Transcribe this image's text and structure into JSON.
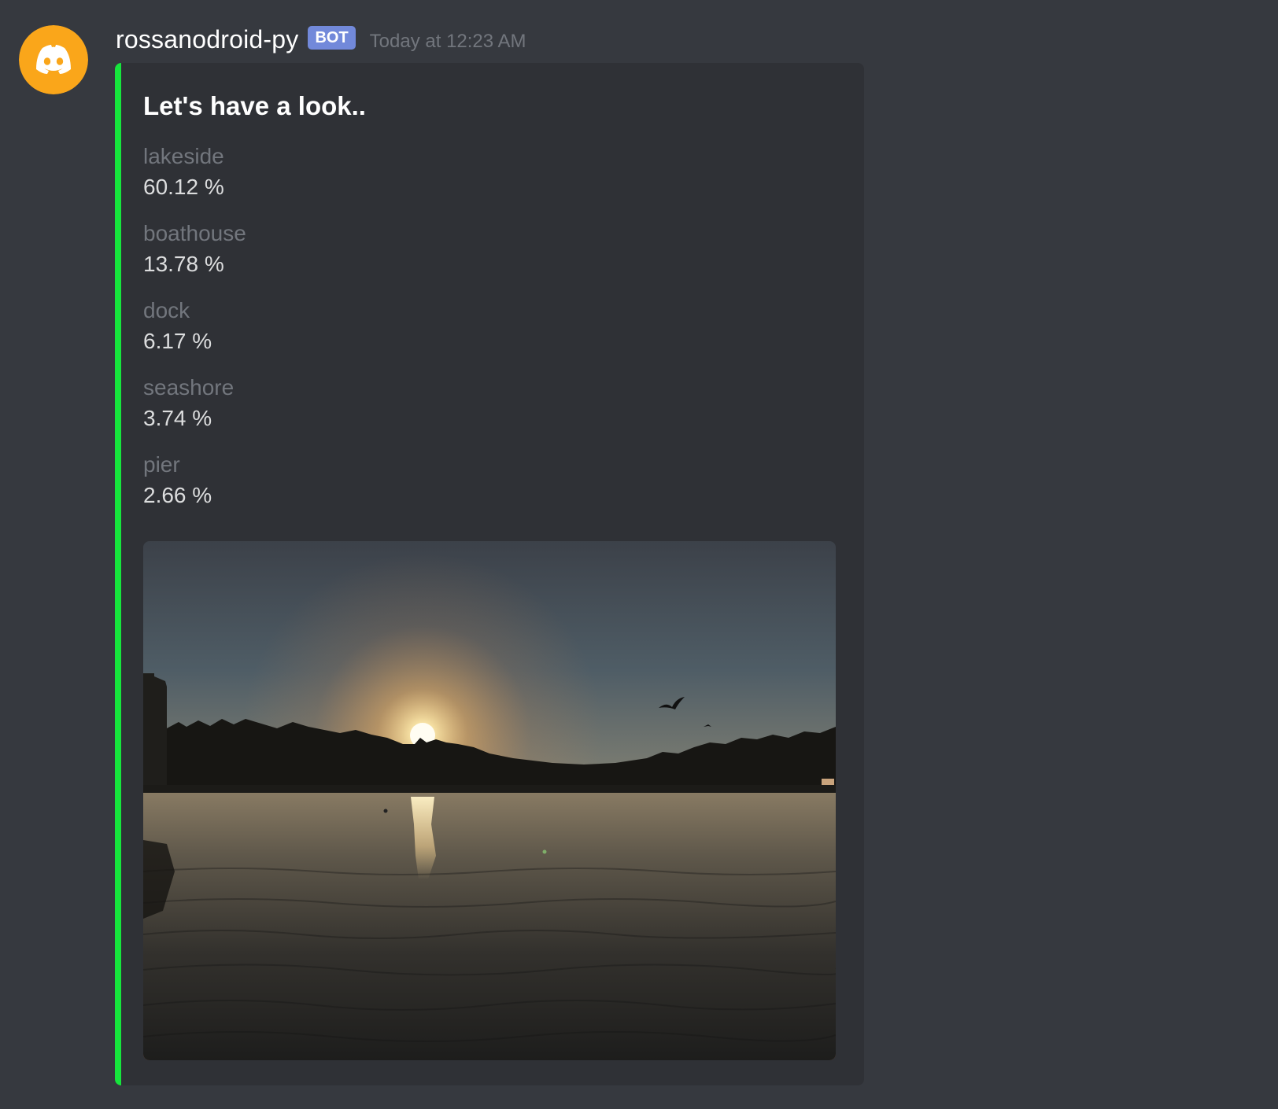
{
  "author": {
    "username": "rossanodroid-py",
    "tag": "BOT",
    "timestamp": "Today at 12:23 AM",
    "avatar_icon": "discord-logo-icon",
    "avatar_color": "#faa61a"
  },
  "embed": {
    "accent_color": "#16e53c",
    "title": "Let's have a look..",
    "fields": [
      {
        "name": "lakeside",
        "value": "60.12 %"
      },
      {
        "name": "boathouse",
        "value": "13.78 %"
      },
      {
        "name": "dock",
        "value": "6.17 %"
      },
      {
        "name": "seashore",
        "value": "3.74 %"
      },
      {
        "name": "pier",
        "value": "2.66 %"
      }
    ]
  }
}
